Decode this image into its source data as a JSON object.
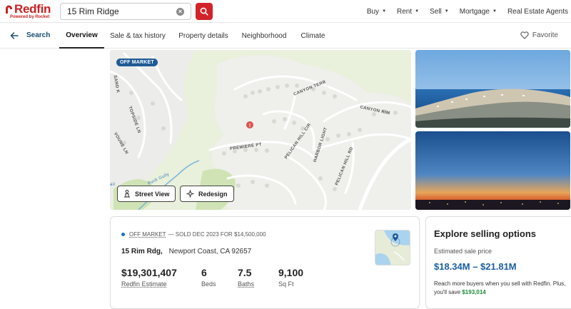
{
  "header": {
    "brand": "Redfin",
    "brand_sub": "Powered by Rocket",
    "search": {
      "value": "15 Rim Ridge"
    },
    "nav": [
      {
        "label": "Buy",
        "has_caret": true
      },
      {
        "label": "Rent",
        "has_caret": true
      },
      {
        "label": "Sell",
        "has_caret": true
      },
      {
        "label": "Mortgage",
        "has_caret": true
      },
      {
        "label": "Real Estate Agents",
        "has_caret": false
      }
    ]
  },
  "tabs": {
    "back_label": "Search",
    "items": [
      "Overview",
      "Sale & tax history",
      "Property details",
      "Neighborhood",
      "Climate"
    ],
    "active": "Overview",
    "favorite_label": "Favorite"
  },
  "map": {
    "badge": "OFF MARKET",
    "streets": [
      "CANYON TERR",
      "CANYON RIM",
      "PREMIERE PT",
      "PELICAN HILL CIR",
      "HARBOR LIGHT",
      "PELICAN HILL RD",
      "TOPSIDE LN",
      "SAND K",
      "VOUNE LN",
      "Buck Gully",
      "ail"
    ],
    "street_view_label": "Street View",
    "redesign_label": "Redesign"
  },
  "listing": {
    "status_badge": "OFF MARKET",
    "status_rest": "— SOLD DEC 2023 FOR $14,500,000",
    "street": "15 Rim Rdg,",
    "city": "Newport Coast, CA 92657",
    "stats": [
      {
        "value": "$19,301,407",
        "label": "Redfin Estimate"
      },
      {
        "value": "6",
        "label": "Beds"
      },
      {
        "value": "7.5",
        "label": "Baths"
      },
      {
        "value": "9,100",
        "label": "Sq Ft"
      }
    ]
  },
  "selling": {
    "title": "Explore selling options",
    "sub": "Estimated sale price",
    "range": "$18.34M – $21.81M",
    "desc": "Reach more buyers when you sell with Redfin. Plus, you'll save",
    "save": "$193,014"
  },
  "colors": {
    "brand_red": "#c82021",
    "search_button": "#d2232a",
    "accent_blue": "#1b5e9e",
    "badge_blue": "#1f5b95",
    "save_green": "#1c8a3b"
  }
}
